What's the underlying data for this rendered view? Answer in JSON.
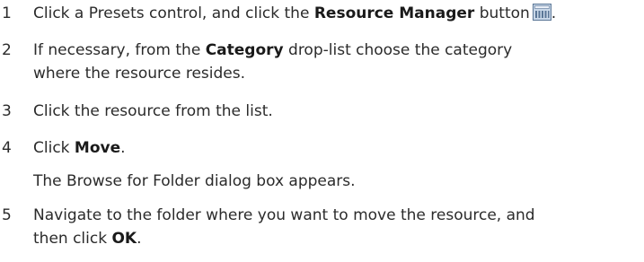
{
  "steps": [
    {
      "number": "1",
      "text_before": "Click a Presets control, and click the ",
      "bold": "Resource Manager",
      "text_after": " button",
      "icon": "resource-manager-icon",
      "trailing": "."
    },
    {
      "number": "2",
      "text_before": "If necessary, from the ",
      "bold": "Category",
      "text_after": " drop-list choose the category",
      "line2": "where the resource resides."
    },
    {
      "number": "3",
      "text": "Click the resource from the list."
    },
    {
      "number": "4",
      "text_before": "Click ",
      "bold": "Move",
      "trailing": ".",
      "note": "The Browse for Folder dialog box appears."
    },
    {
      "number": "5",
      "line1": "Navigate to the folder where you want to move the resource, and",
      "line2_before": "then click ",
      "bold": "OK",
      "trailing": "."
    }
  ],
  "colors": {
    "text": "#2b2b2b",
    "icon_fill": "#c8d7e8",
    "icon_stroke": "#5a7696"
  }
}
